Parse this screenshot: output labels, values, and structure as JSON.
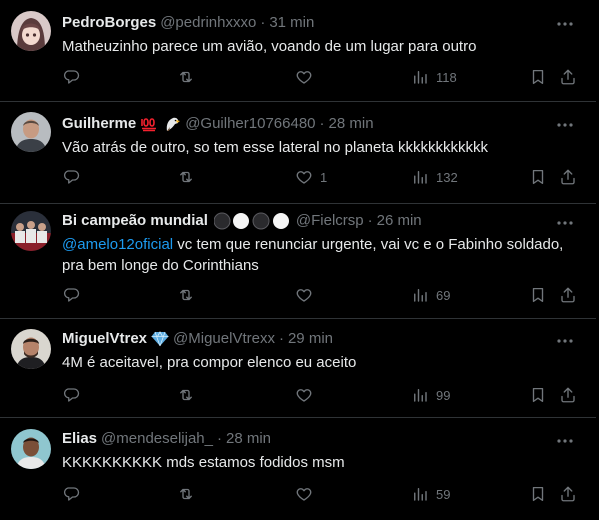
{
  "tweets": [
    {
      "name": "PedroBorges",
      "handle": "@pedrinhxxxo",
      "dot": "·",
      "time": "31 min",
      "text": "Matheuzinho parece um avião, voando de um lugar para outro",
      "mention": "",
      "likes": "",
      "views": "118",
      "avatar_icon": "anime-character-avatar"
    },
    {
      "name": "Guilherme",
      "handle": "@Guilher10766480",
      "dot": "·",
      "time": "28 min",
      "text": "Vão atrás de outro, so tem esse lateral no planeta kkkkkkkkkkkk",
      "mention": "",
      "likes": "1",
      "views": "132",
      "badges": [
        "hundred-points-emoji",
        "eagle-emoji"
      ],
      "avatar_icon": "man-photo-avatar"
    },
    {
      "name": "Bi campeão mundial",
      "handle": "@Fielcrsp",
      "dot": "·",
      "time": "26 min",
      "mention": "@amelo12oficial",
      "text": " vc tem que renunciar urgente, vai vc e o Fabinho soldado, pra bem longe do Corinthians",
      "likes": "",
      "views": "69",
      "badges": [
        "black-circle",
        "white-circle",
        "black-circle",
        "white-circle"
      ],
      "avatar_icon": "team-photo-avatar"
    },
    {
      "name": "MiguelVtrex",
      "handle": "@MiguelVtrexx",
      "dot": "·",
      "time": "29 min",
      "text": "4M é aceitavel, pra compor elenco eu aceito",
      "mention": "",
      "likes": "",
      "views": "99",
      "badges": [
        "gem-emoji"
      ],
      "avatar_icon": "player-photo-avatar"
    },
    {
      "name": "Elias",
      "handle": "@mendeselijah_",
      "dot": "·",
      "time": "28 min",
      "text": "KKKKKKKKKK mds estamos fodidos msm",
      "mention": "",
      "likes": "",
      "views": "59",
      "avatar_icon": "man-photo-avatar"
    }
  ],
  "colors": {
    "background": "#000000",
    "text": "#e7e9ea",
    "muted": "#71767b",
    "mention": "#1d9bf0",
    "divider": "#2f3336"
  }
}
